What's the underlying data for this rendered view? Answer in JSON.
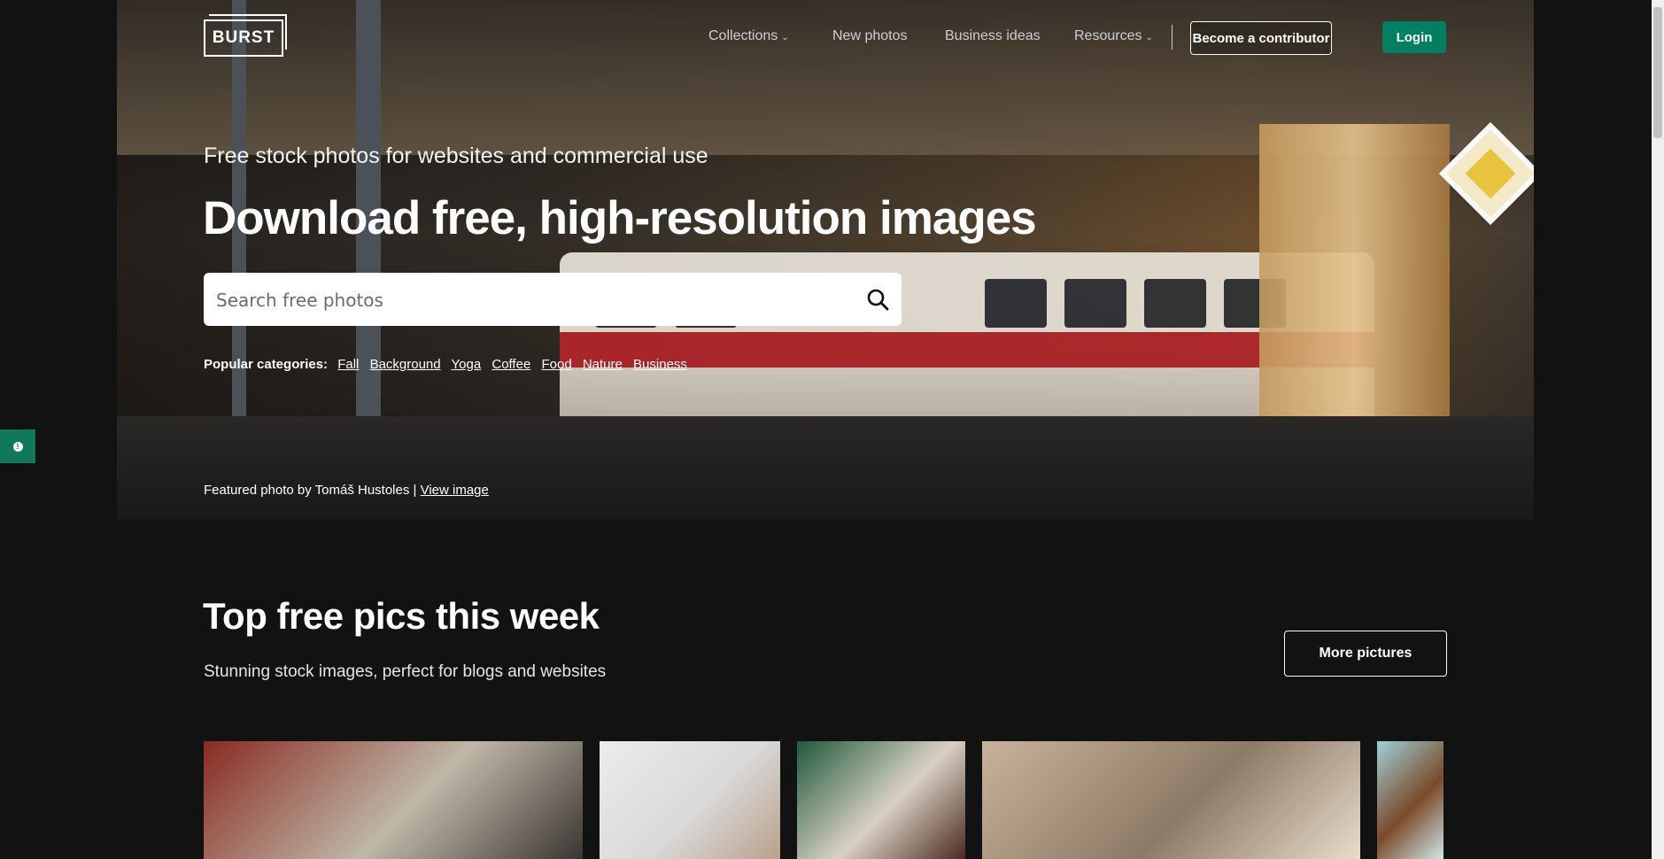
{
  "brand": {
    "logo_text": "BURST"
  },
  "nav": {
    "items": [
      {
        "label": "Collections",
        "has_caret": true
      },
      {
        "label": "New photos",
        "has_caret": false
      },
      {
        "label": "Business ideas",
        "has_caret": false
      },
      {
        "label": "Resources",
        "has_caret": true
      }
    ],
    "contributor_label": "Become a contributor",
    "login_label": "Login"
  },
  "hero": {
    "subtitle": "Free stock photos for websites and commercial use",
    "headline": "Download free, high-resolution images",
    "search_placeholder": "Search free photos",
    "categories_label": "Popular categories:",
    "categories": [
      "Fall",
      "Background",
      "Yoga",
      "Coffee",
      "Food",
      "Nature",
      "Business"
    ],
    "featured_text": "Featured photo by Tomáš Hustoles |",
    "featured_link": "View image"
  },
  "section": {
    "title": "Top free pics this week",
    "subtitle": "Stunning stock images, perfect for blogs and websites",
    "more_label": "More pictures"
  },
  "thumbnails": [
    {
      "name": "street-storefront-photo",
      "colors": [
        "#8a2b22",
        "#bfb7a8",
        "#3b3632"
      ]
    },
    {
      "name": "woman-portrait-photo",
      "colors": [
        "#ececec",
        "#d9d9d9",
        "#b9a08a"
      ]
    },
    {
      "name": "magazine-reading-photo",
      "colors": [
        "#1f5a3b",
        "#d9d0c3",
        "#4a2a22"
      ]
    },
    {
      "name": "book-pages-photo",
      "colors": [
        "#c9b29a",
        "#8d7a66",
        "#e8dccb"
      ]
    },
    {
      "name": "brush-on-blue-photo",
      "colors": [
        "#9fd0d8",
        "#7a4a2a",
        "#cfe7ea"
      ]
    }
  ],
  "colors": {
    "accent_green": "#008060",
    "background": "#121212"
  }
}
